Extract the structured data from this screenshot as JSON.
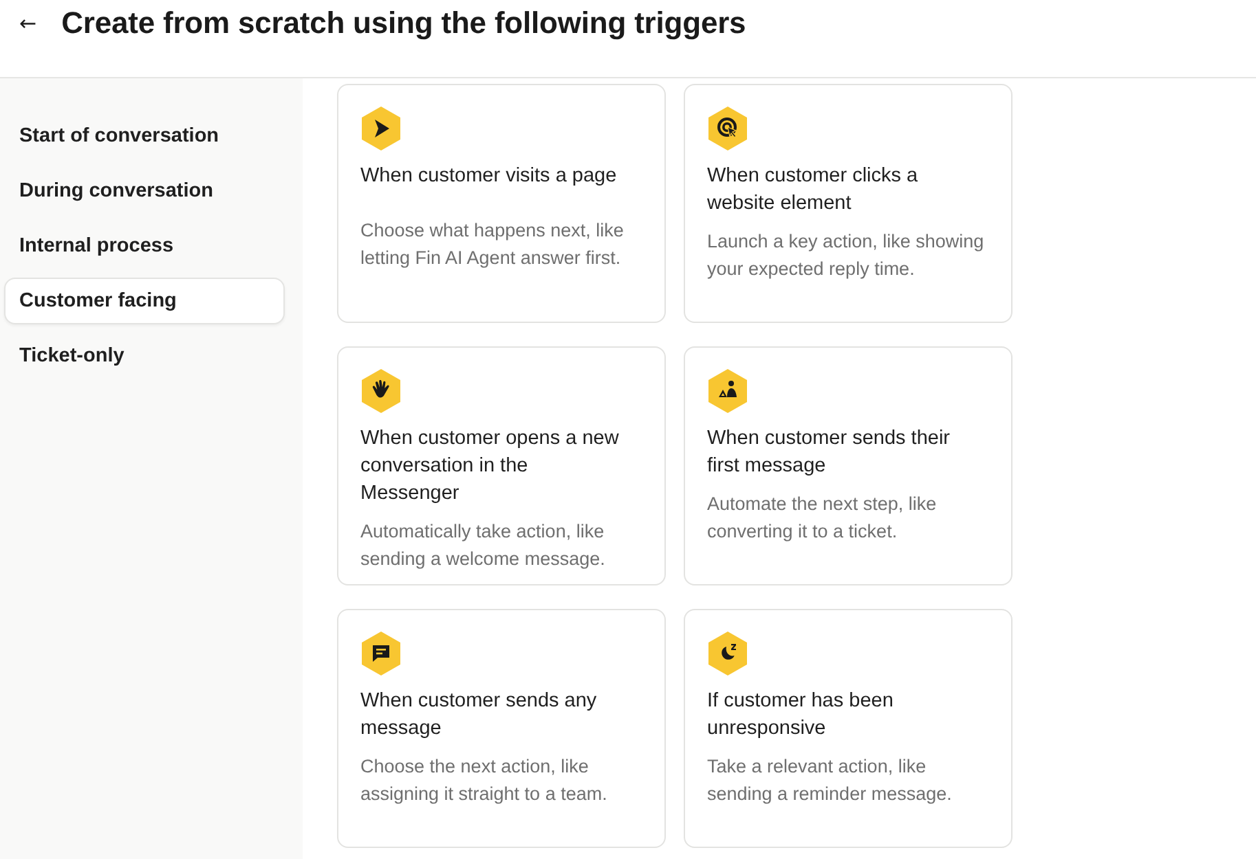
{
  "header": {
    "back": "←",
    "title": "Create from scratch using the following triggers"
  },
  "sidebar": {
    "items": [
      {
        "label": "Start of conversation",
        "selected": false
      },
      {
        "label": "During conversation",
        "selected": false
      },
      {
        "label": "Internal process",
        "selected": false
      },
      {
        "label": "Customer facing",
        "selected": true
      },
      {
        "label": "Ticket-only",
        "selected": false
      }
    ]
  },
  "cards": [
    {
      "title": "When customer visits a page",
      "description": "Choose what happens next, like letting Fin AI Agent answer first."
    },
    {
      "title": "When customer clicks a website element",
      "description": "Launch a key action, like showing your expected reply time."
    },
    {
      "title": "When customer opens a new conversation in the Messenger",
      "description": "Automatically take action, like sending a welcome message."
    },
    {
      "title": "When customer sends their first message",
      "description": "Automate the next step, like converting it to a ticket."
    },
    {
      "title": "When customer sends any message",
      "description": "Choose the next action, like assigning it straight to a team."
    },
    {
      "title": "If customer has been unresponsive",
      "description": "Take a relevant action, like sending a reminder message."
    }
  ]
}
